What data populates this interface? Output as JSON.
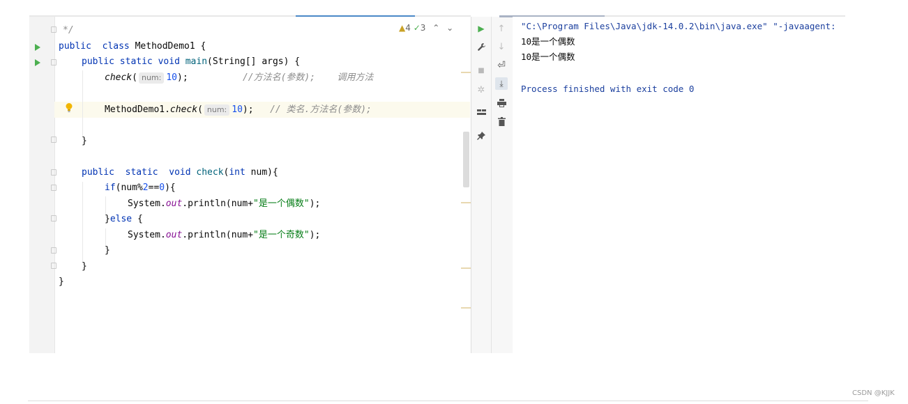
{
  "editor": {
    "inspections": {
      "warnings": "4",
      "weak_warnings": "3"
    },
    "code": {
      "l1": {
        "comment": "*/"
      },
      "l2": {
        "kw_public": "public",
        "kw_class": "class",
        "name": "MethodDemo1 {"
      },
      "l3": {
        "kw_public": "public",
        "kw_static": "static",
        "kw_void": "void",
        "fn_main": "main",
        "rest": "(String[] args) {"
      },
      "l4": {
        "call": "check",
        "open": "(",
        "hint": "num:",
        "arg": "10",
        "close": ");",
        "comment": "//方法名(参数);    调用方法"
      },
      "l6": {
        "cls": "MethodDemo1.",
        "call": "check",
        "open": "(",
        "hint": "num:",
        "arg": "10",
        "close": ");",
        "comment": "// 类名.方法名(参数);"
      },
      "l8": {
        "brace": "}"
      },
      "l10": {
        "kw_public": "public",
        "kw_static": "static",
        "kw_void": "void",
        "fn": "check",
        "open": "(",
        "kw_int": "int",
        "rest": " num){"
      },
      "l11": {
        "kw_if": "if",
        "a": "(num%",
        "n1": "2",
        "b": "==",
        "n2": "0",
        "c": "){"
      },
      "l12": {
        "a": "System.",
        "out": "out",
        "b": ".println(num+",
        "str": "\"是一个偶数\"",
        "c": ");"
      },
      "l13": {
        "a": "}",
        "kw_else": "else",
        "b": " {"
      },
      "l14": {
        "a": "System.",
        "out": "out",
        "b": ".println(num+",
        "str": "\"是一个奇数\"",
        "c": ");"
      },
      "l15": {
        "brace": "}"
      },
      "l16": {
        "brace": "}"
      },
      "l17": {
        "brace": "}"
      }
    }
  },
  "run_toolbar": {
    "icons": [
      "rerun-icon",
      "wrench-icon",
      "stop-icon",
      "debug-icon",
      "layout-icon",
      "pin-icon",
      "up-arrow-icon",
      "down-arrow-icon",
      "soft-wrap-icon",
      "scroll-to-end-icon",
      "print-icon",
      "trash-icon"
    ]
  },
  "console": {
    "lines": [
      "\"C:\\Program Files\\Java\\jdk-14.0.2\\bin\\java.exe\" \"-javaagent:",
      "10是一个偶数",
      "10是一个偶数",
      "",
      "Process finished with exit code 0"
    ]
  },
  "watermark": "CSDN @KJJK",
  "colors": {
    "keyword": "#0033b3",
    "number": "#1750eb",
    "string": "#067d17",
    "console_cmd": "#1b3f9e",
    "console_exit": "#1b3f9e",
    "run_green": "#4caf50"
  }
}
